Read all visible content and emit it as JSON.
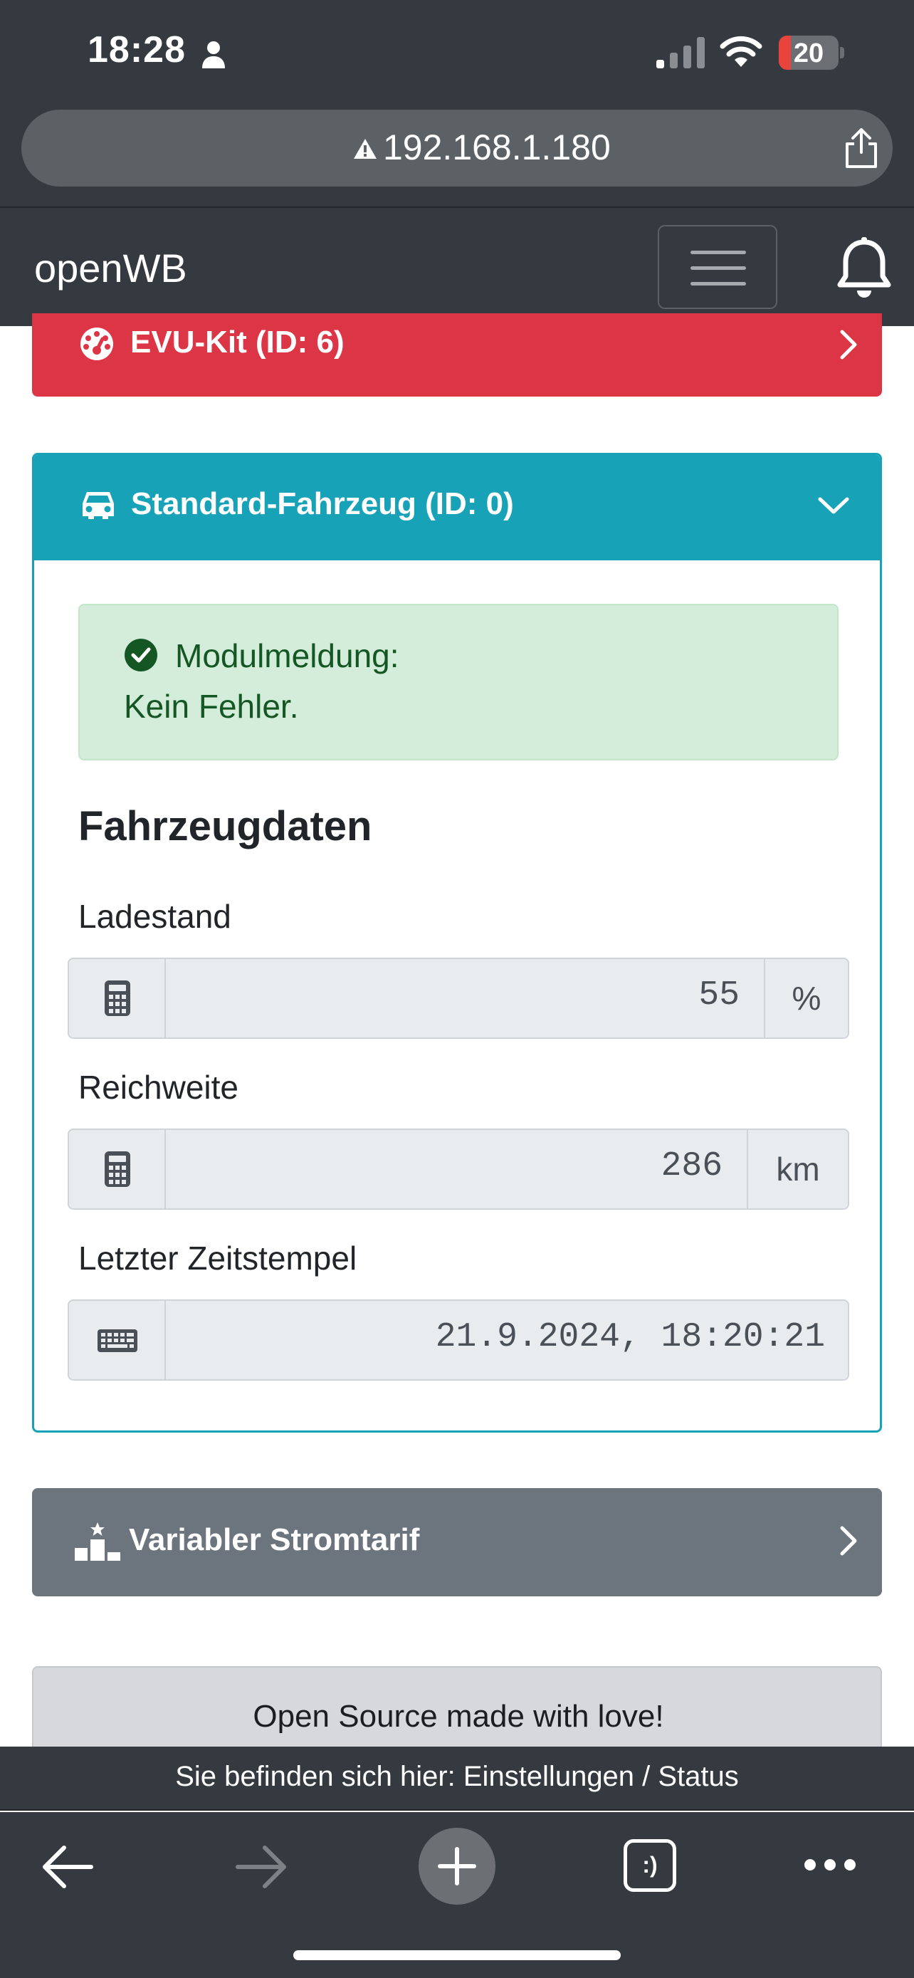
{
  "status_bar": {
    "time": "18:28",
    "battery_level": "20",
    "battery_fraction": 0.2
  },
  "browser": {
    "url": "192.168.1.180",
    "tabs_label": ":)"
  },
  "navbar": {
    "brand": "openWB"
  },
  "evu_card": {
    "title": "EVU-Kit (ID: 6)",
    "color": "#dc3545"
  },
  "vehicle_card": {
    "title": "Standard-Fahrzeug (ID: 0)",
    "color": "#17a2b8",
    "alert": {
      "title": "Modulmeldung:",
      "message": "Kein Fehler."
    },
    "section_title": "Fahrzeugdaten",
    "fields": [
      {
        "label": "Ladestand",
        "value": "55",
        "unit": "%",
        "icon": "calculator-icon"
      },
      {
        "label": "Reichweite",
        "value": "286",
        "unit": "km",
        "icon": "calculator-icon"
      },
      {
        "label": "Letzter Zeitstempel",
        "value": "21.9.2024, 18:20:21",
        "icon": "keyboard-icon"
      }
    ]
  },
  "tariff_card": {
    "title": "Variabler Stromtarif",
    "color": "#6c757d"
  },
  "footer": {
    "text": "Open Source made with love!"
  },
  "breadcrumb": {
    "text": "Sie befinden sich hier: Einstellungen / Status"
  }
}
